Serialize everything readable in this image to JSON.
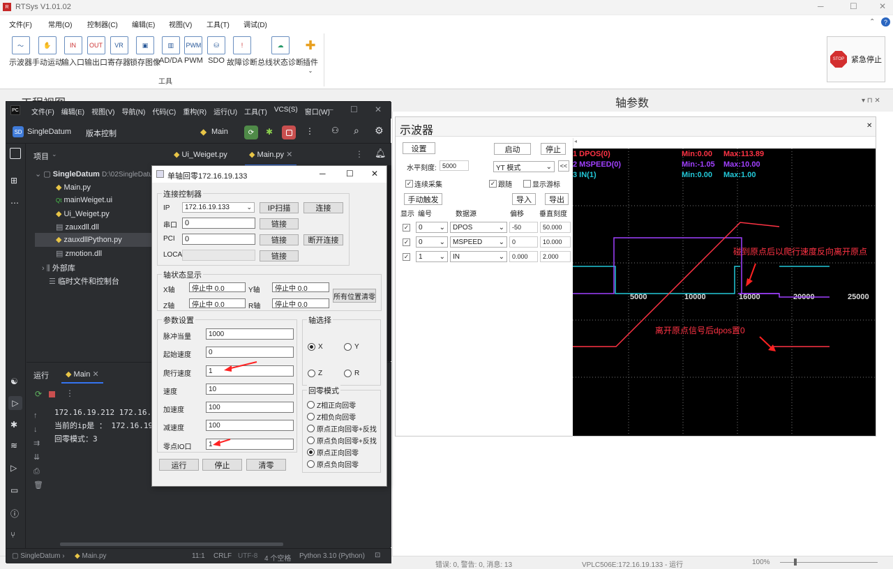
{
  "app": {
    "title": "RTSys V1.01.02",
    "menu": [
      "文件(F)",
      "常用(O)",
      "控制器(C)",
      "编辑(E)",
      "视图(V)",
      "工具(T)",
      "调试(D)"
    ],
    "toolbar": [
      "示波器",
      "手动运动",
      "输入口",
      "输出口",
      "寄存器",
      "锁存图像",
      "AD/DA",
      "PWM",
      "SDO",
      "故障诊断",
      "总线状态诊断",
      "插件"
    ],
    "toolbar_group": "工具",
    "estop": "紧急停止",
    "estop_icon": "STOP",
    "project_panel": "工程视图",
    "axis_panel": "轴参数",
    "status": {
      "errors": "错误: 0, 警告: 0, 消息: 13",
      "device": "VPLC506E:172.16.19.133 - 运行",
      "zoom": "100%"
    }
  },
  "pycharm": {
    "menu": [
      "文件(F)",
      "编辑(E)",
      "视图(V)",
      "导航(N)",
      "代码(C)",
      "重构(R)",
      "运行(U)",
      "工具(T)",
      "VCS(S)",
      "窗口(W)"
    ],
    "project": "SingleDatum",
    "project_badge": "SD",
    "vcs": "版本控制",
    "run_config": "Main",
    "tabs": [
      "Ui_Weiget.py",
      "Main.py"
    ],
    "tree_header": "项目",
    "tree": [
      {
        "label": "SingleDatum",
        "path": "D:\\02SingleDatum"
      },
      {
        "label": "Main.py"
      },
      {
        "label": "mainWeiget.ui"
      },
      {
        "label": "Ui_Weiget.py"
      },
      {
        "label": "zauxdll.dll"
      },
      {
        "label": "zauxdllPython.py"
      },
      {
        "label": "zmotion.dll"
      },
      {
        "label": "外部库"
      },
      {
        "label": "临时文件和控制台"
      }
    ],
    "run_tab_label": "运行",
    "run_tab": "Main",
    "console": [
      "172.16.19.212 172.16.1",
      "当前的ip是 ： 172.16.19.",
      "回零模式：3"
    ],
    "statusbar": {
      "crumb1": "SingleDatum",
      "crumb2": "Main.py",
      "pos": "11:1",
      "eol": "CRLF",
      "enc": "UTF-8",
      "indent": "4 个空格",
      "interp": "Python 3.10 (Python)"
    }
  },
  "dialog": {
    "title": "单轴回零172.16.19.133",
    "conn": {
      "title": "连接控制器",
      "ip_label": "IP",
      "ip": "172.16.19.133",
      "ip_scan": "IP扫描",
      "connect": "连接",
      "com_label": "串口",
      "com": "0",
      "pci_label": "PCI",
      "pci": "0",
      "local_label": "LOCAL",
      "link": "链接",
      "disconnect": "断开连接"
    },
    "axstat": {
      "title": "轴状态显示",
      "x": "X轴",
      "y": "Y轴",
      "z": "Z轴",
      "r": "R轴",
      "val": "停止中  0.0",
      "clear": "所有位置清零"
    },
    "params": {
      "title": "参数设置",
      "rows": [
        {
          "label": "脉冲当量",
          "value": "1000"
        },
        {
          "label": "起始速度",
          "value": "0"
        },
        {
          "label": "爬行速度",
          "value": "1"
        },
        {
          "label": "速度",
          "value": "10"
        },
        {
          "label": "加速度",
          "value": "100"
        },
        {
          "label": "减速度",
          "value": "100"
        },
        {
          "label": "零点IO口",
          "value": "1"
        }
      ]
    },
    "axsel": {
      "title": "轴选择",
      "opts": [
        "X",
        "Y",
        "Z",
        "R"
      ],
      "selected": "X"
    },
    "homemode": {
      "title": "回零模式",
      "opts": [
        "Z相正向回零",
        "Z相负向回零",
        "原点正向回零+反找",
        "原点负向回零+反找",
        "原点正向回零",
        "原点负向回零"
      ],
      "selected": 4
    },
    "buttons": {
      "run": "运行",
      "stop": "停止",
      "clear": "清零"
    }
  },
  "scope": {
    "title": "示波器",
    "settings": "设置",
    "start": "启动",
    "stop": "停止",
    "hscale_label": "水平刻度:",
    "hscale": "5000",
    "mode": "YT 模式",
    "nav": "<<",
    "continuous": "连续采集",
    "follow": "跟随",
    "cursor": "显示游标",
    "manual": "手动触发",
    "import": "导入",
    "export": "导出",
    "cols": [
      "显示",
      "编号",
      "数据源",
      "偏移",
      "垂直刻度"
    ],
    "channels": [
      {
        "num": "0",
        "src": "DPOS",
        "offset": "-50",
        "scale": "50.000",
        "color": "#ff3344",
        "label": "1 DPOS(0)",
        "min": "Min:0.00",
        "max": "Max:113.89"
      },
      {
        "num": "0",
        "src": "MSPEED",
        "offset": "0",
        "scale": "10.000",
        "color": "#a040ff",
        "label": "2 MSPEED(0)",
        "min": "Min:-1.05",
        "max": "Max:10.00"
      },
      {
        "num": "1",
        "src": "IN",
        "offset": "0.000",
        "scale": "2.000",
        "color": "#22c8d8",
        "label": "3 IN(1)",
        "min": "Min:0.00",
        "max": "Max:1.00"
      }
    ],
    "xticks": [
      "5000",
      "10000",
      "16000",
      "20000",
      "25000"
    ],
    "note1": "碰到原点后以爬行速度反向离开原点",
    "note2": "离开原点信号后dpos置0"
  }
}
